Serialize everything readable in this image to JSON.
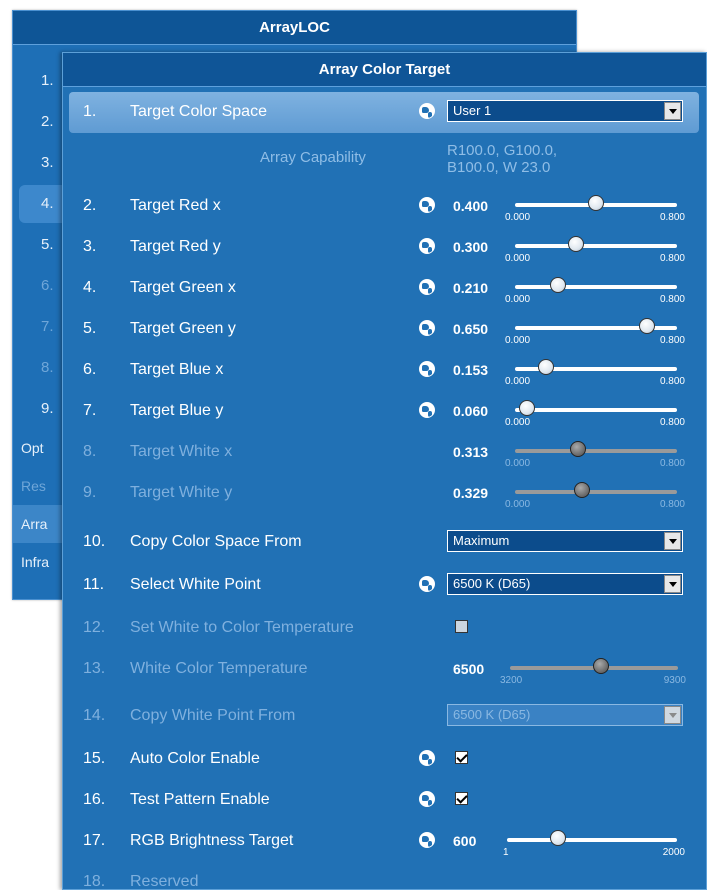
{
  "background_window": {
    "title": "ArrayLOC",
    "rows": [
      {
        "num": "1.",
        "state": "normal"
      },
      {
        "num": "2.",
        "state": "normal"
      },
      {
        "num": "3.",
        "state": "normal"
      },
      {
        "num": "4.",
        "state": "selected"
      },
      {
        "num": "5.",
        "state": "normal"
      },
      {
        "num": "6.",
        "state": "dim"
      },
      {
        "num": "7.",
        "state": "dim"
      },
      {
        "num": "8.",
        "state": "dim"
      },
      {
        "num": "9.",
        "state": "normal"
      }
    ],
    "categories": [
      {
        "label": "Opt",
        "state": "normal"
      },
      {
        "label": "Res",
        "state": "dim"
      },
      {
        "label": "Arra",
        "state": "selected"
      },
      {
        "label": "Infra",
        "state": "normal"
      }
    ]
  },
  "panel": {
    "title": "Array Color Target",
    "array_capability": {
      "label": "Array Capability",
      "line1": "R100.0, G100.0,",
      "line2": "B100.0, W 23.0"
    },
    "items": {
      "target_color_space": {
        "num": "1.",
        "label": "Target Color Space",
        "value": "User 1"
      },
      "target_red_x": {
        "num": "2.",
        "label": "Target Red x",
        "value": "0.400",
        "min": "0.000",
        "max": "0.800",
        "fraction": 0.5
      },
      "target_red_y": {
        "num": "3.",
        "label": "Target Red y",
        "value": "0.300",
        "min": "0.000",
        "max": "0.800",
        "fraction": 0.375
      },
      "target_green_x": {
        "num": "4.",
        "label": "Target Green x",
        "value": "0.210",
        "min": "0.000",
        "max": "0.800",
        "fraction": 0.2625
      },
      "target_green_y": {
        "num": "5.",
        "label": "Target Green y",
        "value": "0.650",
        "min": "0.000",
        "max": "0.800",
        "fraction": 0.8125
      },
      "target_blue_x": {
        "num": "6.",
        "label": "Target Blue x",
        "value": "0.153",
        "min": "0.000",
        "max": "0.800",
        "fraction": 0.191
      },
      "target_blue_y": {
        "num": "7.",
        "label": "Target Blue y",
        "value": "0.060",
        "min": "0.000",
        "max": "0.800",
        "fraction": 0.075
      },
      "target_white_x": {
        "num": "8.",
        "label": "Target White x",
        "value": "0.313",
        "min": "0.000",
        "max": "0.800",
        "fraction": 0.391
      },
      "target_white_y": {
        "num": "9.",
        "label": "Target White y",
        "value": "0.329",
        "min": "0.000",
        "max": "0.800",
        "fraction": 0.411
      },
      "copy_color_space_from": {
        "num": "10.",
        "label": "Copy Color Space From",
        "value": "Maximum"
      },
      "select_white_point": {
        "num": "11.",
        "label": "Select White Point",
        "value": "6500 K (D65)"
      },
      "set_white_to_color_temperature": {
        "num": "12.",
        "label": "Set White to Color Temperature",
        "checked": false
      },
      "white_color_temperature": {
        "num": "13.",
        "label": "White Color Temperature",
        "value": "6500",
        "min": "3200",
        "max": "9300",
        "fraction": 0.54
      },
      "copy_white_point_from": {
        "num": "14.",
        "label": "Copy White Point From",
        "value": "6500 K (D65)"
      },
      "auto_color_enable": {
        "num": "15.",
        "label": "Auto Color Enable",
        "checked": true
      },
      "test_pattern_enable": {
        "num": "16.",
        "label": "Test Pattern Enable",
        "checked": true
      },
      "rgb_brightness_target": {
        "num": "17.",
        "label": "RGB Brightness Target",
        "value": "600",
        "min": "1",
        "max": "2000",
        "fraction": 0.3
      },
      "reserved": {
        "num": "18.",
        "label": "Reserved"
      }
    }
  }
}
